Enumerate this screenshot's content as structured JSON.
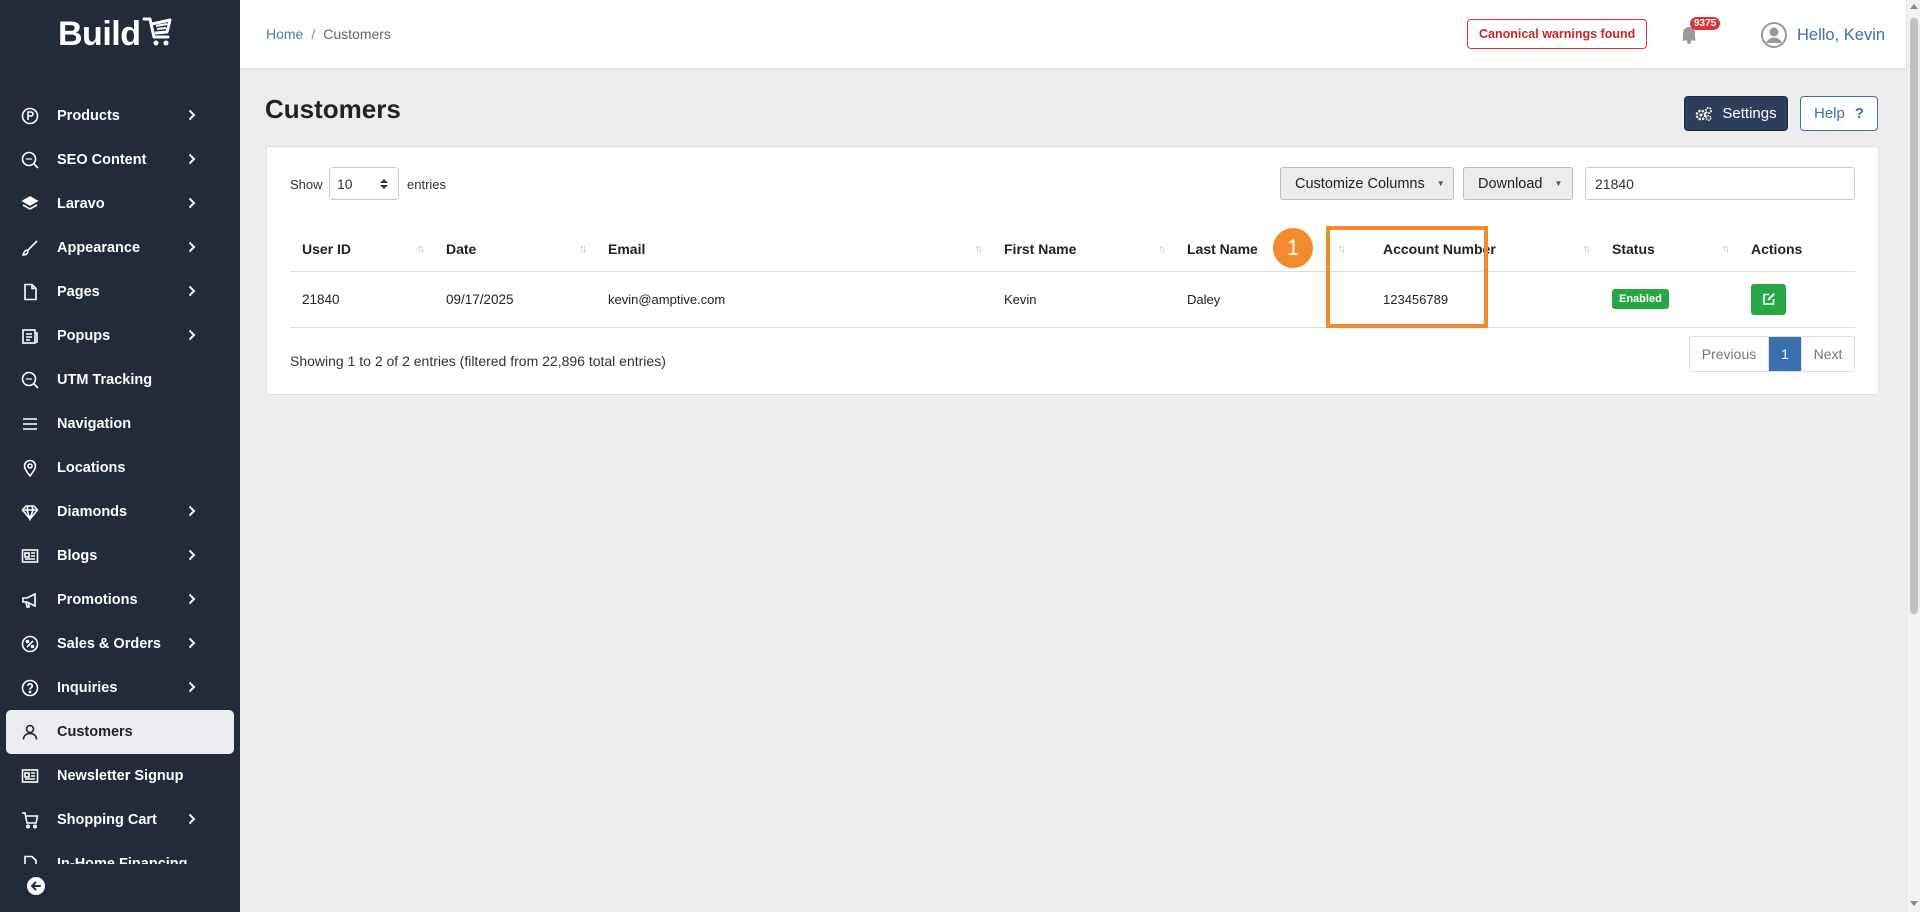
{
  "brand": {
    "logo_text": "Build"
  },
  "sidebar": {
    "items": [
      {
        "label": "Products",
        "icon": "circle-p-icon",
        "has_submenu": true
      },
      {
        "label": "SEO Content",
        "icon": "seo-icon",
        "has_submenu": true
      },
      {
        "label": "Laravo",
        "icon": "layers-icon",
        "has_submenu": true
      },
      {
        "label": "Appearance",
        "icon": "brush-icon",
        "has_submenu": true
      },
      {
        "label": "Pages",
        "icon": "file-icon",
        "has_submenu": true
      },
      {
        "label": "Popups",
        "icon": "popup-icon",
        "has_submenu": true
      },
      {
        "label": "UTM Tracking",
        "icon": "seo-icon",
        "has_submenu": false
      },
      {
        "label": "Navigation",
        "icon": "menu-icon",
        "has_submenu": false
      },
      {
        "label": "Locations",
        "icon": "map-pin-icon",
        "has_submenu": false
      },
      {
        "label": "Diamonds",
        "icon": "diamond-icon",
        "has_submenu": true
      },
      {
        "label": "Blogs",
        "icon": "newspaper-icon",
        "has_submenu": true
      },
      {
        "label": "Promotions",
        "icon": "megaphone-icon",
        "has_submenu": true
      },
      {
        "label": "Sales & Orders",
        "icon": "percent-icon",
        "has_submenu": true
      },
      {
        "label": "Inquiries",
        "icon": "question-icon",
        "has_submenu": true
      },
      {
        "label": "Customers",
        "icon": "user-icon",
        "has_submenu": false,
        "active": true
      },
      {
        "label": "Newsletter Signup",
        "icon": "newspaper-icon",
        "has_submenu": false
      },
      {
        "label": "Shopping Cart",
        "icon": "cart-icon",
        "has_submenu": true
      },
      {
        "label": "In-Home Financing",
        "icon": "file-icon",
        "has_submenu": true
      }
    ]
  },
  "topbar": {
    "breadcrumb": {
      "home": "Home",
      "separator": "/",
      "current": "Customers"
    },
    "warning": "Canonical warnings found",
    "notification_count": "9375",
    "greeting": "Hello, Kevin"
  },
  "page": {
    "title": "Customers",
    "settings_label": "Settings",
    "help_label": "Help",
    "help_symbol": "?"
  },
  "table_controls": {
    "show_label": "Show",
    "entries_label": "entries",
    "page_length": "10",
    "customize_label": "Customize Columns",
    "download_label": "Download",
    "search_value": "21840"
  },
  "table": {
    "columns": [
      "User ID",
      "Date",
      "Email",
      "First Name",
      "Last Name",
      "Account Number",
      "Status",
      "Actions"
    ],
    "rows": [
      {
        "user_id": "21840",
        "date": "09/17/2025",
        "email": "kevin@amptive.com",
        "first_name": "Kevin",
        "last_name": "Daley",
        "account_number": "123456789",
        "status": "Enabled"
      }
    ]
  },
  "footer": {
    "info": "Showing 1 to 2 of 2 entries (filtered from 22,896 total entries)",
    "prev": "Previous",
    "page": "1",
    "next": "Next"
  },
  "annotation": {
    "step": "1"
  },
  "colors": {
    "sidebar_bg": "#212b3a",
    "accent_blue": "#3c6fb0",
    "success": "#27a844",
    "highlight": "#f28a2e",
    "warning": "#c62828"
  }
}
